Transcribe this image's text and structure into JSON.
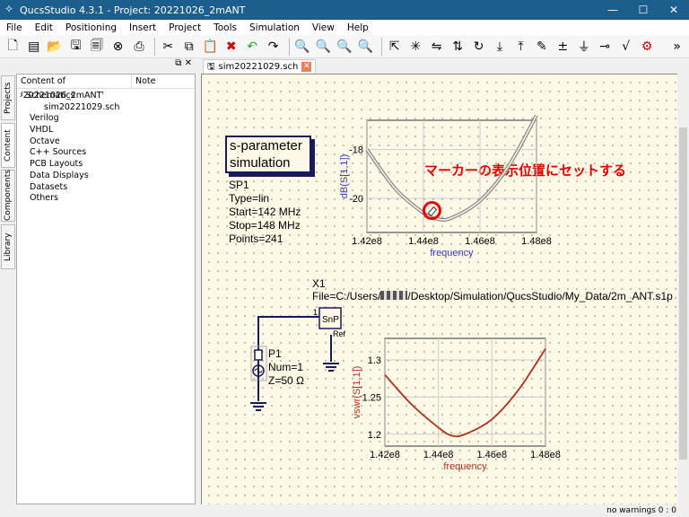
{
  "window": {
    "title": "QucsStudio 4.3.1 - Project: 20221026_2mANT"
  },
  "menu": [
    "File",
    "Edit",
    "Positioning",
    "Insert",
    "Project",
    "Tools",
    "Simulation",
    "View",
    "Help"
  ],
  "toolbar_icons": [
    "new-icon",
    "new-text-icon",
    "open-icon",
    "save-icon",
    "save-all-icon",
    "close-icon",
    "print-icon",
    "cut-icon",
    "copy-icon",
    "paste-icon",
    "delete-icon",
    "undo-icon",
    "redo-icon",
    "zoom-fit-icon",
    "zoom-100-icon",
    "zoom-in-icon",
    "zoom-out-icon",
    "select-icon",
    "deactivate-icon",
    "mirror-x-icon",
    "mirror-y-icon",
    "rotate-icon",
    "enter-subcircuit-icon",
    "leave-subcircuit-icon",
    "wire-icon",
    "label-icon",
    "ground-icon",
    "port-icon",
    "equation-icon",
    "simulate-icon"
  ],
  "toolbar_more": "»",
  "left_panel": {
    "vertical_tabs": [
      "Projects",
      "Content",
      "Components",
      "Library"
    ],
    "header": {
      "col1": "Content of '20221026_2mANT'",
      "col2": "Note"
    },
    "tree": [
      {
        "label": "Schematics",
        "level": 0,
        "expanded": true
      },
      {
        "label": "sim20221029.sch",
        "level": 1
      },
      {
        "label": "Verilog",
        "level": 0
      },
      {
        "label": "VHDL",
        "level": 0
      },
      {
        "label": "Octave",
        "level": 0
      },
      {
        "label": "C++ Sources",
        "level": 0
      },
      {
        "label": "PCB Layouts",
        "level": 0
      },
      {
        "label": "Data Displays",
        "level": 0
      },
      {
        "label": "Datasets",
        "level": 0
      },
      {
        "label": "Others",
        "level": 0
      }
    ]
  },
  "tab": {
    "label": "sim20221029.sch"
  },
  "schematic": {
    "sim_block": {
      "title": "s-parameter simulation",
      "props": [
        "SP1",
        "Type=lin",
        "Start=142 MHz",
        "Stop=148 MHz",
        "Points=241"
      ]
    },
    "snp": {
      "name": "X1",
      "file": "File=C:/Users/",
      "file_rest": "/Desktop/Simulation/QucsStudio/My_Data/2m_ANT.s1p",
      "label": "SnP",
      "pin": "1",
      "ref": "Ref"
    },
    "port": {
      "props": [
        "P1",
        "Num=1",
        "Z=50 Ω"
      ]
    },
    "annotation": "マーカーの表示位置にセットする",
    "annotation_color": "#e00000"
  },
  "chart_data": [
    {
      "type": "line",
      "xlabel": "frequency",
      "ylabel": "dB(S[1,1])",
      "x": [
        142000000.0,
        143000000.0,
        144000000.0,
        144500000.0,
        145000000.0,
        146000000.0,
        147000000.0,
        148000000.0
      ],
      "y": [
        -18.0,
        -19.6,
        -20.6,
        -20.85,
        -20.8,
        -20.1,
        -18.7,
        -16.6
      ],
      "xticks": [
        "1.42e8",
        "1.44e8",
        "1.46e8",
        "1.48e8"
      ],
      "yticks": [
        "-18",
        "-20"
      ],
      "xlim": [
        142000000.0,
        148000000.0
      ],
      "ylim": [
        -21.4,
        -16.8
      ],
      "grid": true,
      "line_color": "#888888",
      "label_color": "#3a3ab0",
      "marker": {
        "x": 144300000.0,
        "y": -20.5
      }
    },
    {
      "type": "line",
      "xlabel": "frequency",
      "ylabel": "vswr(S[1,1])",
      "x": [
        142000000.0,
        143000000.0,
        144000000.0,
        144500000.0,
        145000000.0,
        146000000.0,
        147000000.0,
        148000000.0
      ],
      "y": [
        1.28,
        1.24,
        1.209,
        1.198,
        1.2,
        1.22,
        1.26,
        1.315
      ],
      "xticks": [
        "1.42e8",
        "1.44e8",
        "1.46e8",
        "1.48e8"
      ],
      "yticks": [
        "1.3",
        "1.25",
        "1.2"
      ],
      "xlim": [
        142000000.0,
        148000000.0
      ],
      "ylim": [
        1.184,
        1.329
      ],
      "grid": true,
      "line_color": "#b03020",
      "label_color": "#b03020"
    }
  ],
  "status": {
    "text": "no warnings  0 : 0"
  }
}
